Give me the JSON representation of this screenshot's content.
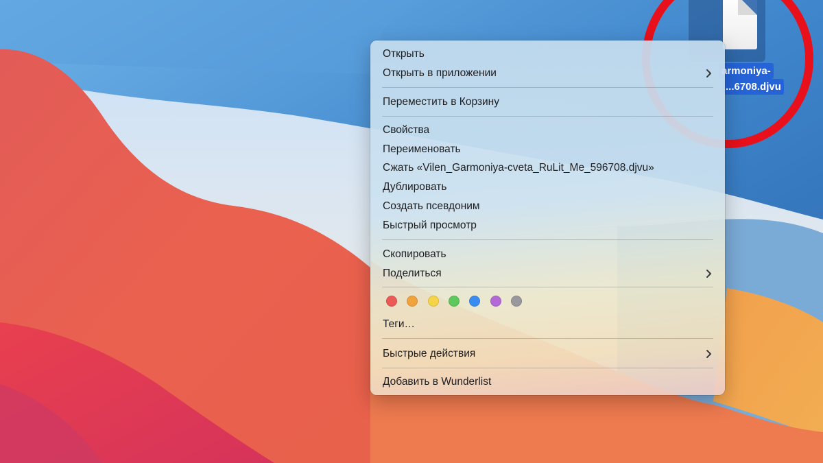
{
  "desktop_file": {
    "name_line1": "armoniya-",
    "name_line2": "...6708.djvu",
    "icon": "document-icon"
  },
  "context_menu": {
    "open": "Открыть",
    "open_with": "Открыть в приложении",
    "move_to_trash": "Переместить в Корзину",
    "get_info": "Свойства",
    "rename": "Переименовать",
    "compress": "Сжать «Vilen_Garmoniya-cveta_RuLit_Me_596708.djvu»",
    "duplicate": "Дублировать",
    "make_alias": "Создать псевдоним",
    "quick_look": "Быстрый просмотр",
    "copy": "Скопировать",
    "share": "Поделиться",
    "tags": "Теги…",
    "quick_actions": "Быстрые действия",
    "add_to_wunderlist": "Добавить в Wunderlist",
    "tag_colors": [
      {
        "name": "red",
        "color": "#ec5a57"
      },
      {
        "name": "orange",
        "color": "#f0a23c"
      },
      {
        "name": "yellow",
        "color": "#f5d547"
      },
      {
        "name": "green",
        "color": "#5cc95a"
      },
      {
        "name": "blue",
        "color": "#3b8cf0"
      },
      {
        "name": "purple",
        "color": "#b46ad6"
      },
      {
        "name": "gray",
        "color": "#98989d"
      }
    ]
  },
  "annotation": {
    "highlight_color": "#e8101b"
  }
}
